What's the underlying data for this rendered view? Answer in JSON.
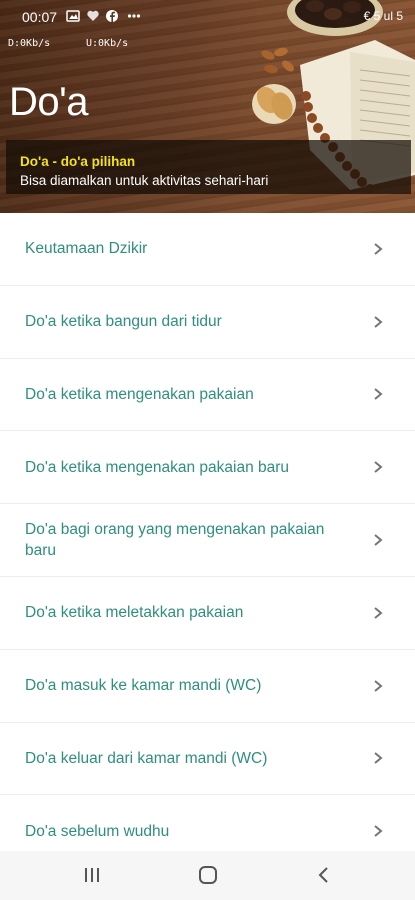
{
  "status_bar": {
    "time": "00:07",
    "icons": [
      "image-icon",
      "heart-icon",
      "facebook-icon",
      "more-dots-icon"
    ],
    "right_text": "€ 5 ul 5"
  },
  "net_speed": {
    "down": "D:0Kb/s",
    "up": "U:0Kb/s"
  },
  "header": {
    "title": "Do'a",
    "banner_title": "Do'a - do'a pilihan",
    "banner_subtitle": "Bisa diamalkan untuk aktivitas sehari-hari"
  },
  "list": {
    "items": [
      {
        "label": "Keutamaan Dzikir"
      },
      {
        "label": "Do'a ketika bangun dari tidur"
      },
      {
        "label": "Do'a ketika mengenakan pakaian"
      },
      {
        "label": "Do'a ketika mengenakan pakaian baru"
      },
      {
        "label": "Do'a bagi orang yang mengenakan pakaian baru"
      },
      {
        "label": "Do'a ketika meletakkan pakaian"
      },
      {
        "label": "Do'a masuk ke kamar mandi (WC)"
      },
      {
        "label": "Do'a keluar dari kamar mandi (WC)"
      },
      {
        "label": "Do'a sebelum wudhu"
      }
    ]
  },
  "navbar": {
    "buttons": [
      "recent-apps-icon",
      "home-icon",
      "back-icon"
    ]
  },
  "colors": {
    "accent_text": "#2f8f7d",
    "banner_title": "#f4e21c",
    "wood": "#5e3620"
  }
}
